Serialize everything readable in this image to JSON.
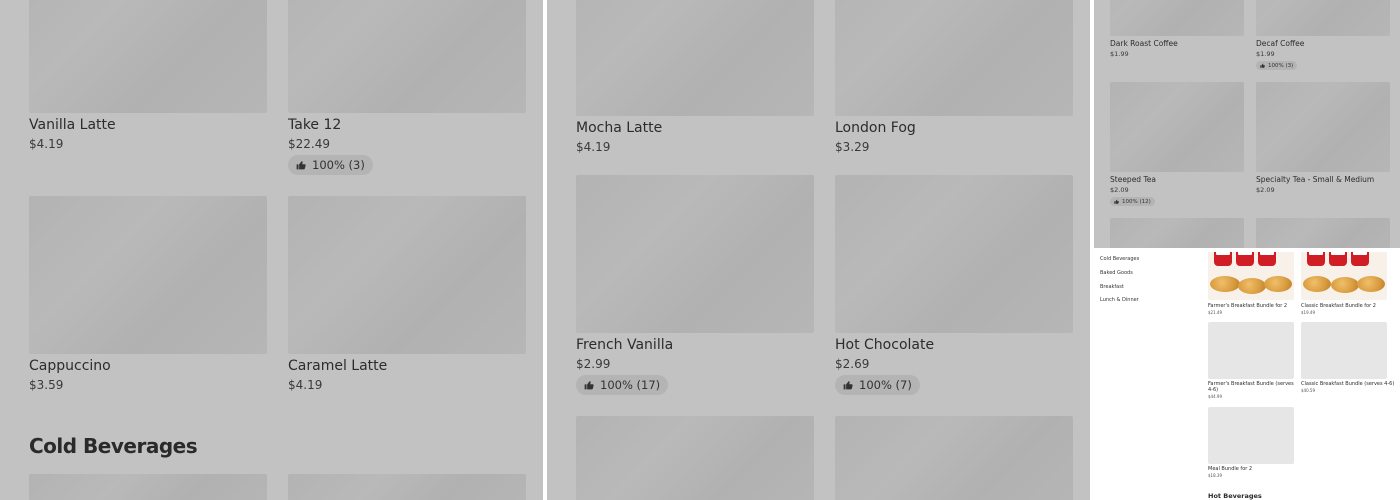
{
  "panel_a": {
    "items": [
      {
        "name": "Vanilla Latte",
        "price": "$4.19",
        "rating": null
      },
      {
        "name": "Take 12",
        "price": "$22.49",
        "rating": "100% (3)"
      },
      {
        "name": "Cappuccino",
        "price": "$3.59",
        "rating": null
      },
      {
        "name": "Caramel Latte",
        "price": "$4.19",
        "rating": null
      }
    ],
    "section_title": "Cold Beverages"
  },
  "panel_b": {
    "items": [
      {
        "name": "Mocha Latte",
        "price": "$4.19",
        "rating": null
      },
      {
        "name": "London Fog",
        "price": "$3.29",
        "rating": null
      },
      {
        "name": "French Vanilla",
        "price": "$2.99",
        "rating": "100% (17)"
      },
      {
        "name": "Hot Chocolate",
        "price": "$2.69",
        "rating": "100% (7)"
      }
    ]
  },
  "panel_c": {
    "items": [
      {
        "name": "Dark Roast Coffee",
        "price": "$1.99",
        "rating": null
      },
      {
        "name": "Decaf Coffee",
        "price": "$1.99",
        "rating": "100% (3)"
      },
      {
        "name": "Steeped Tea",
        "price": "$2.09",
        "rating": "100% (12)"
      },
      {
        "name": "Specialty Tea - Small & Medium",
        "price": "$2.09",
        "rating": null
      }
    ]
  },
  "panel_d": {
    "sidebar": [
      "Cold Beverages",
      "Baked Goods",
      "Breakfast",
      "Lunch & Dinner"
    ],
    "items": [
      {
        "name": "Farmer's Breakfast Bundle for 2",
        "price": "$21.49"
      },
      {
        "name": "Classic Breakfast Bundle for 2",
        "price": "$19.49"
      },
      {
        "name": "Farmer's Breakfast Bundle (serves 4-6)",
        "price": "$44.99"
      },
      {
        "name": "Classic Breakfast Bundle (serves 4-6)",
        "price": "$40.59"
      },
      {
        "name": "Meal Bundle for 2",
        "price": "$18.39"
      }
    ],
    "section_title": "Hot Beverages"
  },
  "icons": {
    "rating": "thumbs-up-icon"
  },
  "colors": {
    "overlay": "#c2c2c2",
    "placeholder": "#b4b4b4",
    "brand_red": "#d11d26"
  }
}
